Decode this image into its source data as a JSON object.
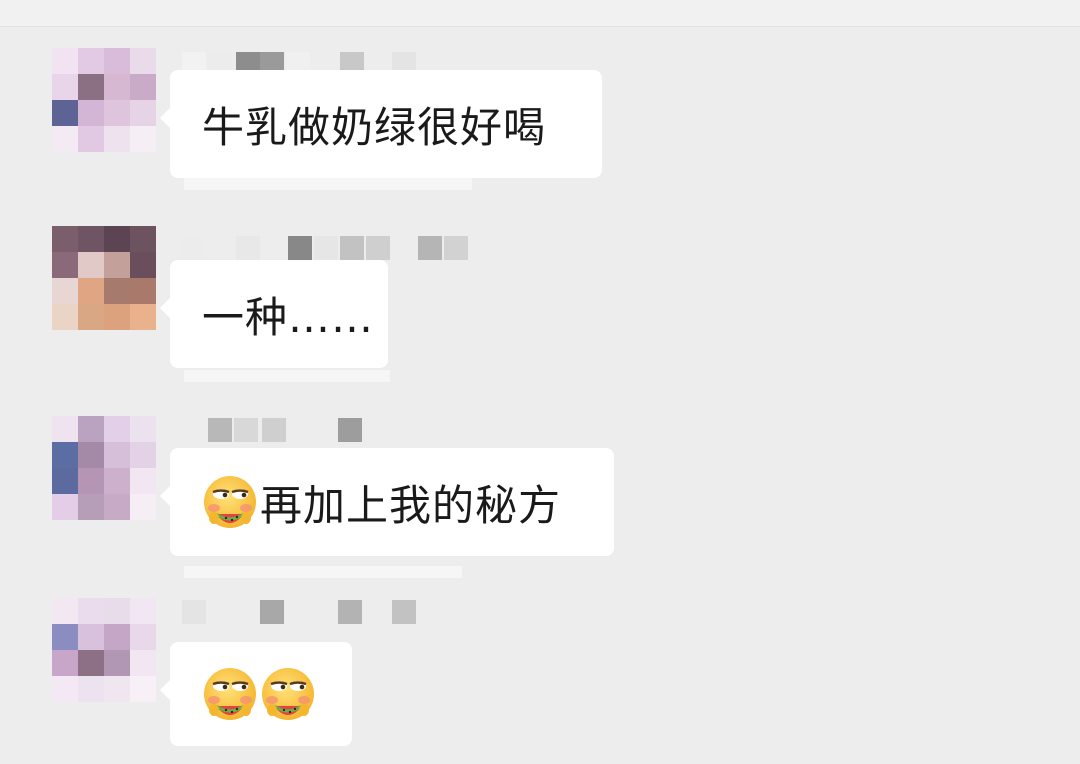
{
  "messages": [
    {
      "text": "牛乳做奶绿很好喝",
      "emoji_count": 0
    },
    {
      "text": "一种……",
      "emoji_count": 0
    },
    {
      "text": "再加上我的秘方",
      "emoji_count": 1
    },
    {
      "text": "",
      "emoji_count": 2
    }
  ],
  "emoji_icon": "melon-eating-smirk-emoji-icon",
  "colors": {
    "background": "#ededed",
    "bubble": "#ffffff",
    "text": "#1a1a1a"
  }
}
